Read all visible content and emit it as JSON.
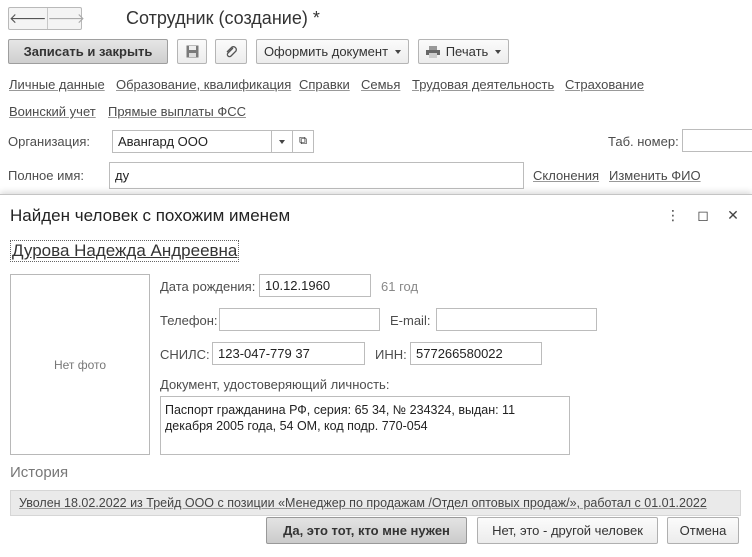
{
  "window": {
    "back_icon": "arrow-left-icon",
    "forward_icon": "arrow-right-icon",
    "title": "Сотрудник (создание) *"
  },
  "toolbar": {
    "save_close": "Записать и закрыть",
    "save_icon": "floppy-icon",
    "attach_icon": "paperclip-icon",
    "create_doc": "Оформить документ",
    "print": "Печать",
    "print_icon": "printer-icon"
  },
  "sections": [
    "Личные данные",
    "Образование, квалификация",
    "Справки",
    "Семья",
    "Трудовая деятельность",
    "Страхование",
    "Воинский учет",
    "Прямые выплаты ФСС"
  ],
  "form": {
    "org_label": "Организация:",
    "org_value": "Авангард ООО",
    "tab_label": "Таб. номер:",
    "tab_value": "",
    "name_label": "Полное имя:",
    "name_value": "ду",
    "declension_link": "Склонения",
    "change_fio_link": "Изменить ФИО"
  },
  "dialog": {
    "title": "Найден человек с похожим именем",
    "person_name": "Дурова Надежда Андреевна",
    "no_photo": "Нет фото",
    "birth_label": "Дата рождения:",
    "birth_value": "10.12.1960",
    "age": "61 год",
    "phone_label": "Телефон:",
    "phone_value": "",
    "email_label": "E-mail:",
    "email_value": "",
    "snils_label": "СНИЛС:",
    "snils_value": "123-047-779 37",
    "inn_label": "ИНН:",
    "inn_value": "577266580022",
    "doc_label": "Документ, удостоверяющий личность:",
    "doc_value": "Паспорт гражданина РФ, серия: 65 34, № 234324, выдан: 11 декабря 2005 года, 54 ОМ, код подр. 770-054",
    "history_title": "История",
    "history_entry": "Уволен 18.02.2022 из Трейд ООО с позиции «Менеджер по продажам /Отдел оптовых продаж/», работал с 01.01.2022",
    "btn_yes": "Да, это тот, кто мне нужен",
    "btn_no": "Нет, это - другой человек",
    "btn_cancel": "Отмена"
  }
}
